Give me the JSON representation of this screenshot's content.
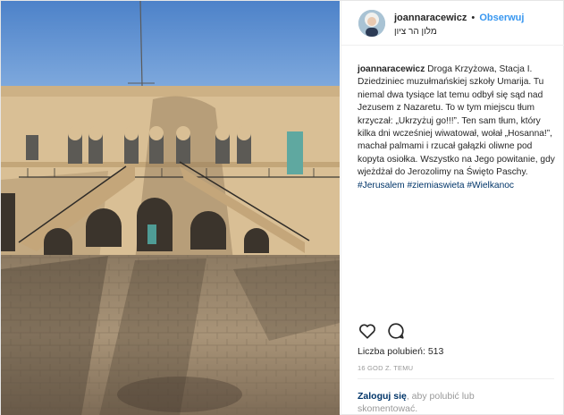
{
  "post": {
    "username": "joannaracewicz",
    "separator": "•",
    "follow_label": "Obserwuj",
    "location": "מלון הר ציון",
    "caption": {
      "username": "joannaracewicz",
      "text": "Droga Krzyżowa, Stacja I. Dziedziniec muzułmańskiej szkoły Umarija. Tu niemal dwa tysiące lat temu odbył się sąd nad Jezusem z Nazaretu. To w tym miejscu tłum krzyczał: „Ukrzyżuj go!!!”. Ten sam tłum, który kilka dni wcześniej wiwatował, wołał „Hosanna!”, machał palmami i rzucał gałązki oliwne pod kopyta osiołka. Wszystko na Jego powitanie, gdy wjeżdżał do Jerozolimy na Święto Paschy.",
      "hashtags": [
        "#Jerusalem",
        "#ziemiaswieta",
        "#Wielkanoc"
      ]
    },
    "likes_label": "Liczba polubień:",
    "likes_count": "513",
    "time_ago": "16 GOD Z. TEMU",
    "login": {
      "link": "Zaloguj się",
      "rest": ", aby polubić lub skomentować."
    },
    "icons": {
      "like": "heart-icon",
      "comment": "comment-icon"
    },
    "colors": {
      "link_blue": "#3897f0",
      "hashtag": "#003569",
      "muted": "#999999"
    }
  }
}
